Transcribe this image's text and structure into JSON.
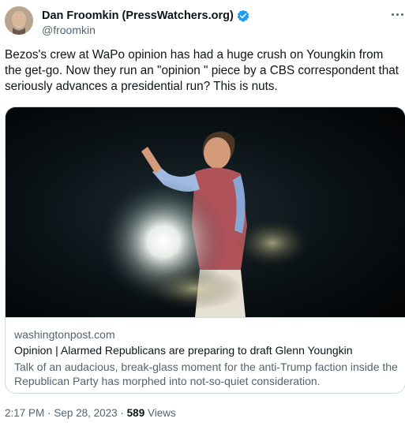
{
  "author": {
    "display_name": "Dan Froomkin (PressWatchers.org)",
    "handle": "@froomkin",
    "verified": true
  },
  "tweet": {
    "text": "Bezos's crew at WaPo opinion has had a huge crush on Youngkin from the get-go. Now they run an \"opinion \" piece by a CBS correspondent that seriously advances a presidential run?  This is nuts."
  },
  "link_card": {
    "domain": "washingtonpost.com",
    "title": "Opinion | Alarmed Republicans are preparing to draft Glenn Youngkin",
    "description": "Talk of an audacious, break-glass moment for the anti-Trump faction inside the Republican Party has morphed into not-so-quiet consideration."
  },
  "meta": {
    "time": "2:17 PM",
    "separator": "·",
    "date": "Sep 28, 2023",
    "views_count": "589",
    "views_label": "Views"
  },
  "colors": {
    "verified_badge": "#1d9bf0",
    "secondary_text": "#536471",
    "primary_text": "#0f1419",
    "border": "#cfd9de"
  },
  "icons": {
    "verified": "verified-badge-icon",
    "more": "more-options-icon"
  }
}
